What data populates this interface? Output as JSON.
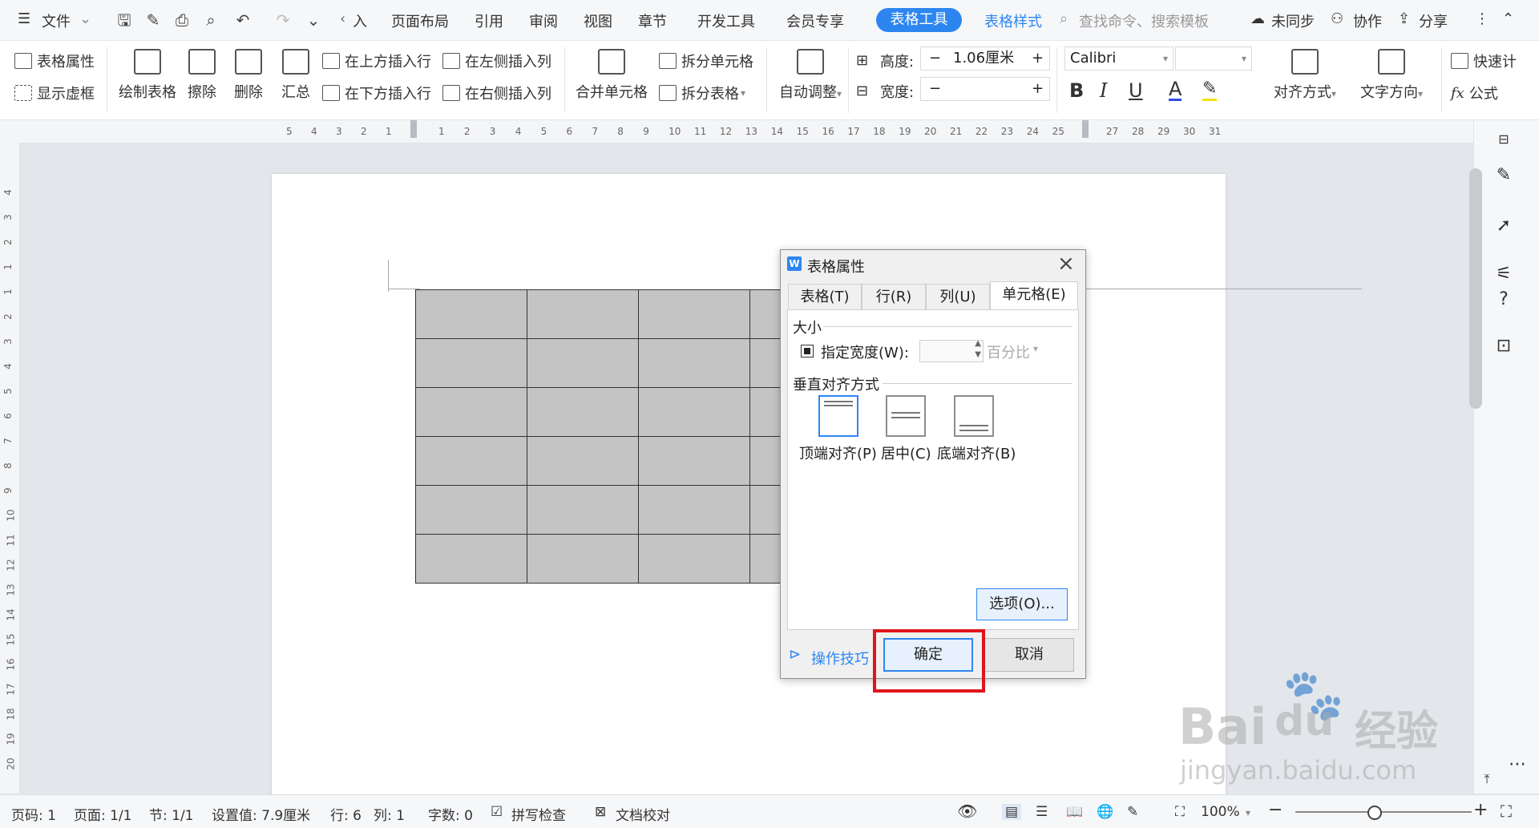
{
  "menu": {
    "file": "文件",
    "tabs": [
      "入",
      "页面布局",
      "引用",
      "审阅",
      "视图",
      "章节",
      "开发工具",
      "会员专享"
    ],
    "active_tab": "表格工具",
    "style_tab": "表格样式",
    "search": "查找命令、搜索模板",
    "right": [
      "未同步",
      "协作",
      "分享"
    ]
  },
  "ribbon": {
    "table_props": "表格属性",
    "show_gridlines": "显示虚框",
    "draw_table": "绘制表格",
    "erase": "擦除",
    "delete": "删除",
    "summary": "汇总",
    "insert_above": "在上方插入行",
    "insert_below": "在下方插入行",
    "insert_left": "在左侧插入列",
    "insert_right": "在右侧插入列",
    "merge_cells": "合并单元格",
    "split_cells": "拆分单元格",
    "split_table": "拆分表格",
    "auto_fit": "自动调整",
    "height_label": "高度:",
    "height_value": "1.06厘米",
    "width_label": "宽度:",
    "font_name": "Calibri",
    "align": "对齐方式",
    "text_dir": "文字方向",
    "quick_calc": "快速计",
    "formula": "公式",
    "minus": "−",
    "plus": "+"
  },
  "hruler": [
    "5",
    "4",
    "3",
    "2",
    "1",
    "1",
    "2",
    "3",
    "4",
    "5",
    "6",
    "7",
    "8",
    "9",
    "10",
    "11",
    "12",
    "13",
    "14",
    "15",
    "16",
    "17",
    "18",
    "19",
    "20",
    "21",
    "22",
    "23",
    "24",
    "25",
    "27",
    "28",
    "29",
    "30",
    "31"
  ],
  "vruler": [
    "4",
    "3",
    "2",
    "1",
    "1",
    "2",
    "3",
    "4",
    "5",
    "6",
    "7",
    "8",
    "9",
    "10",
    "11",
    "12",
    "13",
    "14",
    "15",
    "16",
    "17",
    "18",
    "19",
    "20"
  ],
  "dialog": {
    "logo": "W",
    "title": "表格属性",
    "tabs": [
      "表格(T)",
      "行(R)",
      "列(U)",
      "单元格(E)"
    ],
    "size_heading": "大小",
    "pref_width": "指定宽度(W):",
    "unit": "百分比",
    "valign_heading": "垂直对齐方式",
    "top": "顶端对齐(P)",
    "center": "居中(C)",
    "bottom": "底端对齐(B)",
    "options": "选项(O)...",
    "tips": "操作技巧",
    "ok": "确定",
    "cancel": "取消"
  },
  "status": {
    "page_no": "页码: 1",
    "pages": "页面: 1/1",
    "section": "节: 1/1",
    "setting": "设置值: 7.9厘米",
    "row": "行: 6",
    "col": "列: 1",
    "words": "字数: 0",
    "spell": "拼写检查",
    "proof": "文档校对",
    "zoom": "100%"
  },
  "watermark": {
    "brand": "Bai",
    "brand2": "du",
    "cn": "经验",
    "url": "jingyan.baidu.com"
  },
  "colors": {
    "accent": "#2d86f0",
    "highlight": "#e0141b",
    "cell_fill": "#c4c4c4"
  }
}
